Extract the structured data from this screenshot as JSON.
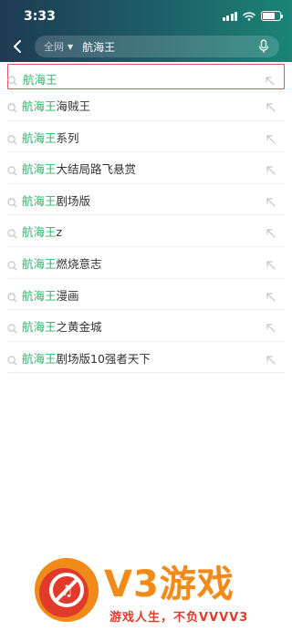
{
  "status_bar": {
    "time": "3:33"
  },
  "search": {
    "scope": "全网",
    "query": "航海王"
  },
  "suggestions": [
    {
      "highlight": "航海王",
      "rest": ""
    },
    {
      "highlight": "航海王",
      "rest": "海贼王"
    },
    {
      "highlight": "航海王",
      "rest": "系列"
    },
    {
      "highlight": "航海王",
      "rest": "大结局路飞悬赏"
    },
    {
      "highlight": "航海王",
      "rest": "剧场版"
    },
    {
      "highlight": "航海王",
      "rest": "z"
    },
    {
      "highlight": "航海王",
      "rest": "燃烧意志"
    },
    {
      "highlight": "航海王",
      "rest": "漫画"
    },
    {
      "highlight": "航海王",
      "rest": "之黄金城"
    },
    {
      "highlight": "航海王",
      "rest": "剧场版10强者天下"
    }
  ],
  "colors": {
    "header_start": "#1d3b52",
    "header_end": "#1a8476",
    "highlight": "#2db46a",
    "selected_border": "#e05560",
    "watermark_orange": "#f08a19",
    "watermark_red": "#e23a2a"
  },
  "watermark": {
    "brand": "V3游戏",
    "slogan": "游戏人生，不负VVVV3"
  }
}
